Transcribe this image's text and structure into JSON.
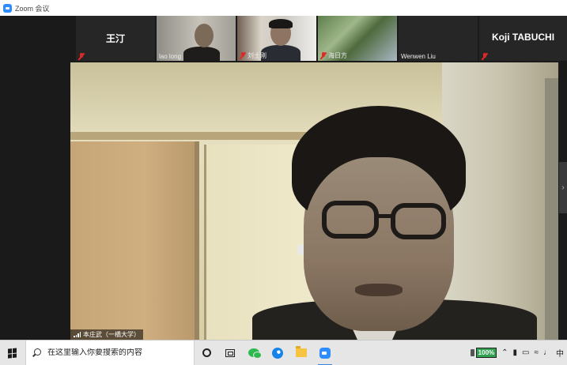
{
  "window": {
    "title": "Zoom 会议"
  },
  "participants": [
    {
      "name": "王汀",
      "caption": "",
      "muted": true,
      "video": false
    },
    {
      "name": "",
      "caption": "lao long",
      "muted": false,
      "video": true
    },
    {
      "name": "",
      "caption": "刘士刚",
      "muted": true,
      "video": true
    },
    {
      "name": "",
      "caption": "海日方",
      "muted": true,
      "video": true
    },
    {
      "name": "",
      "caption": "Wenwen Liu",
      "muted": false,
      "video": false
    },
    {
      "name": "Koji TABUCHI",
      "caption": "",
      "muted": true,
      "video": false
    }
  ],
  "active_speaker": {
    "caption": "本庄武（一橋大学）"
  },
  "taskbar": {
    "search_placeholder": "在这里输入你要搜索的内容",
    "battery_percent": "100%",
    "ime_label": "中",
    "apps": [
      "cortana-icon",
      "task-view-icon",
      "wechat-icon",
      "edge-icon",
      "file-explorer-icon",
      "zoom-icon"
    ]
  },
  "colors": {
    "zoom_blue": "#2d8cff",
    "mute_red": "#e02828",
    "battery_green": "#30a14e"
  }
}
